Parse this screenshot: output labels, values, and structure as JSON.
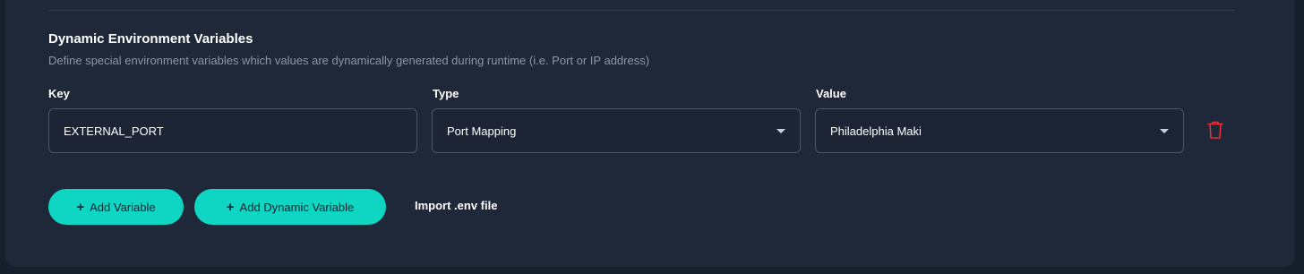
{
  "section": {
    "title": "Dynamic Environment Variables",
    "description": "Define special environment variables which values are dynamically generated during runtime (i.e. Port or IP address)"
  },
  "columns": {
    "key": "Key",
    "type": "Type",
    "value": "Value"
  },
  "row": {
    "key": "EXTERNAL_PORT",
    "type": "Port Mapping",
    "value": "Philadelphia Maki"
  },
  "actions": {
    "add_variable": "Add Variable",
    "add_dynamic_variable": "Add Dynamic Variable",
    "import_env": "Import .env file"
  },
  "colors": {
    "accent": "#0ed6c3",
    "delete": "#e0313b",
    "panel": "#1f2839"
  },
  "icons": {
    "delete": "trash-icon",
    "add": "plus-icon",
    "dropdown": "chevron-down-icon"
  }
}
